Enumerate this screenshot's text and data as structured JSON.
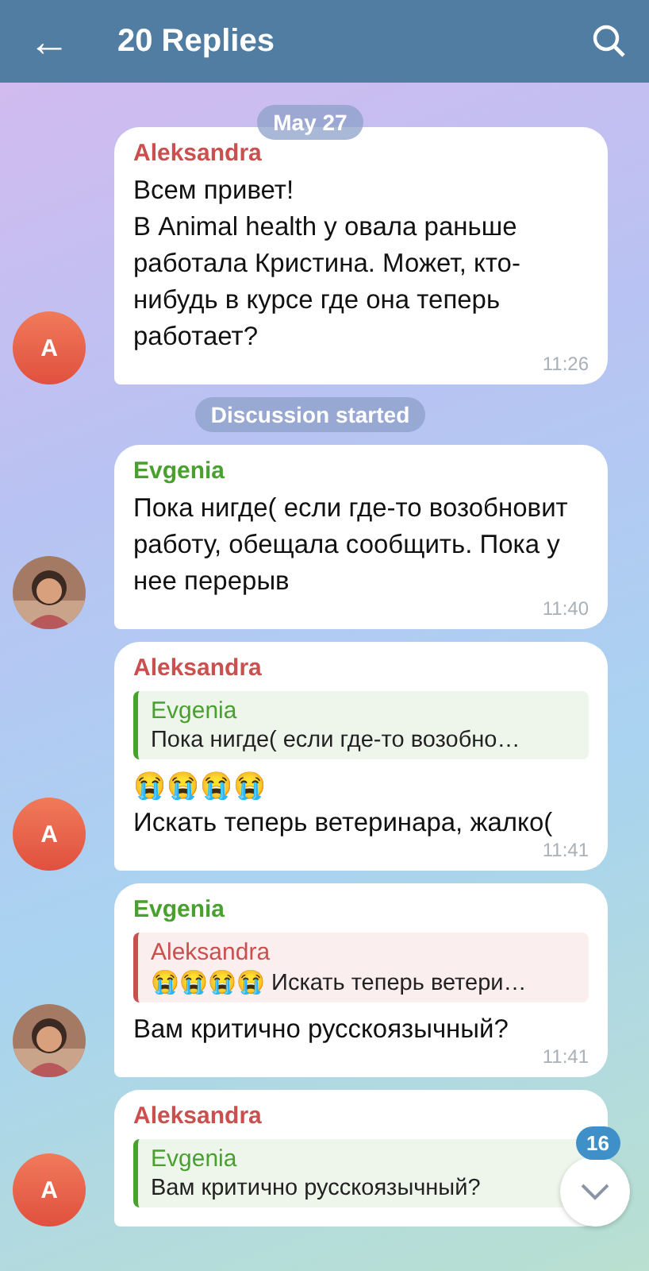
{
  "header": {
    "back": "←",
    "title": "20 Replies"
  },
  "messages": [
    {
      "kind": "date",
      "text": "May 27"
    },
    {
      "kind": "message",
      "author": "Aleksandra",
      "color": "#c9504e",
      "avatar": {
        "kind": "letter",
        "letter": "A"
      },
      "lines": [
        "Всем привет!",
        "В Animal health у овала раньше работала Кристина. Может, кто-нибудь в курсе где она теперь работает?"
      ],
      "time": "11:26"
    },
    {
      "kind": "date",
      "text": "Discussion started"
    },
    {
      "kind": "message",
      "author": "Evgenia",
      "color": "#4aa02f",
      "avatar": {
        "kind": "picture"
      },
      "lines": [
        "Пока нигде( если где-то возобновит работу, обещала сообщить. Пока у нее перерыв"
      ],
      "time": "11:40"
    },
    {
      "kind": "message",
      "author": "Aleksandra",
      "color": "#c9504e",
      "avatar": {
        "kind": "letter",
        "letter": "A"
      },
      "reply": {
        "author": "Evgenia",
        "color": "#4aa02f",
        "text": "Пока нигде( если где-то возобно…"
      },
      "lines": [
        "😭😭😭😭",
        "Искать теперь ветеринара, жалко("
      ],
      "time": "11:41"
    },
    {
      "kind": "message",
      "author": "Evgenia",
      "color": "#4aa02f",
      "avatar": {
        "kind": "picture"
      },
      "reply": {
        "author": "Aleksandra",
        "color": "#c9504e",
        "text": "😭😭😭😭 Искать теперь ветери…"
      },
      "lines": [
        "Вам критично русскоязычный?"
      ],
      "time": "11:41"
    },
    {
      "kind": "message",
      "author": "Aleksandra",
      "color": "#c9504e",
      "avatar": {
        "kind": "letter",
        "letter": "A"
      },
      "reply": {
        "author": "Evgenia",
        "color": "#4aa02f",
        "text": "Вам критично русскоязычный?"
      }
    }
  ],
  "scroll_button": {
    "badge": "16"
  }
}
